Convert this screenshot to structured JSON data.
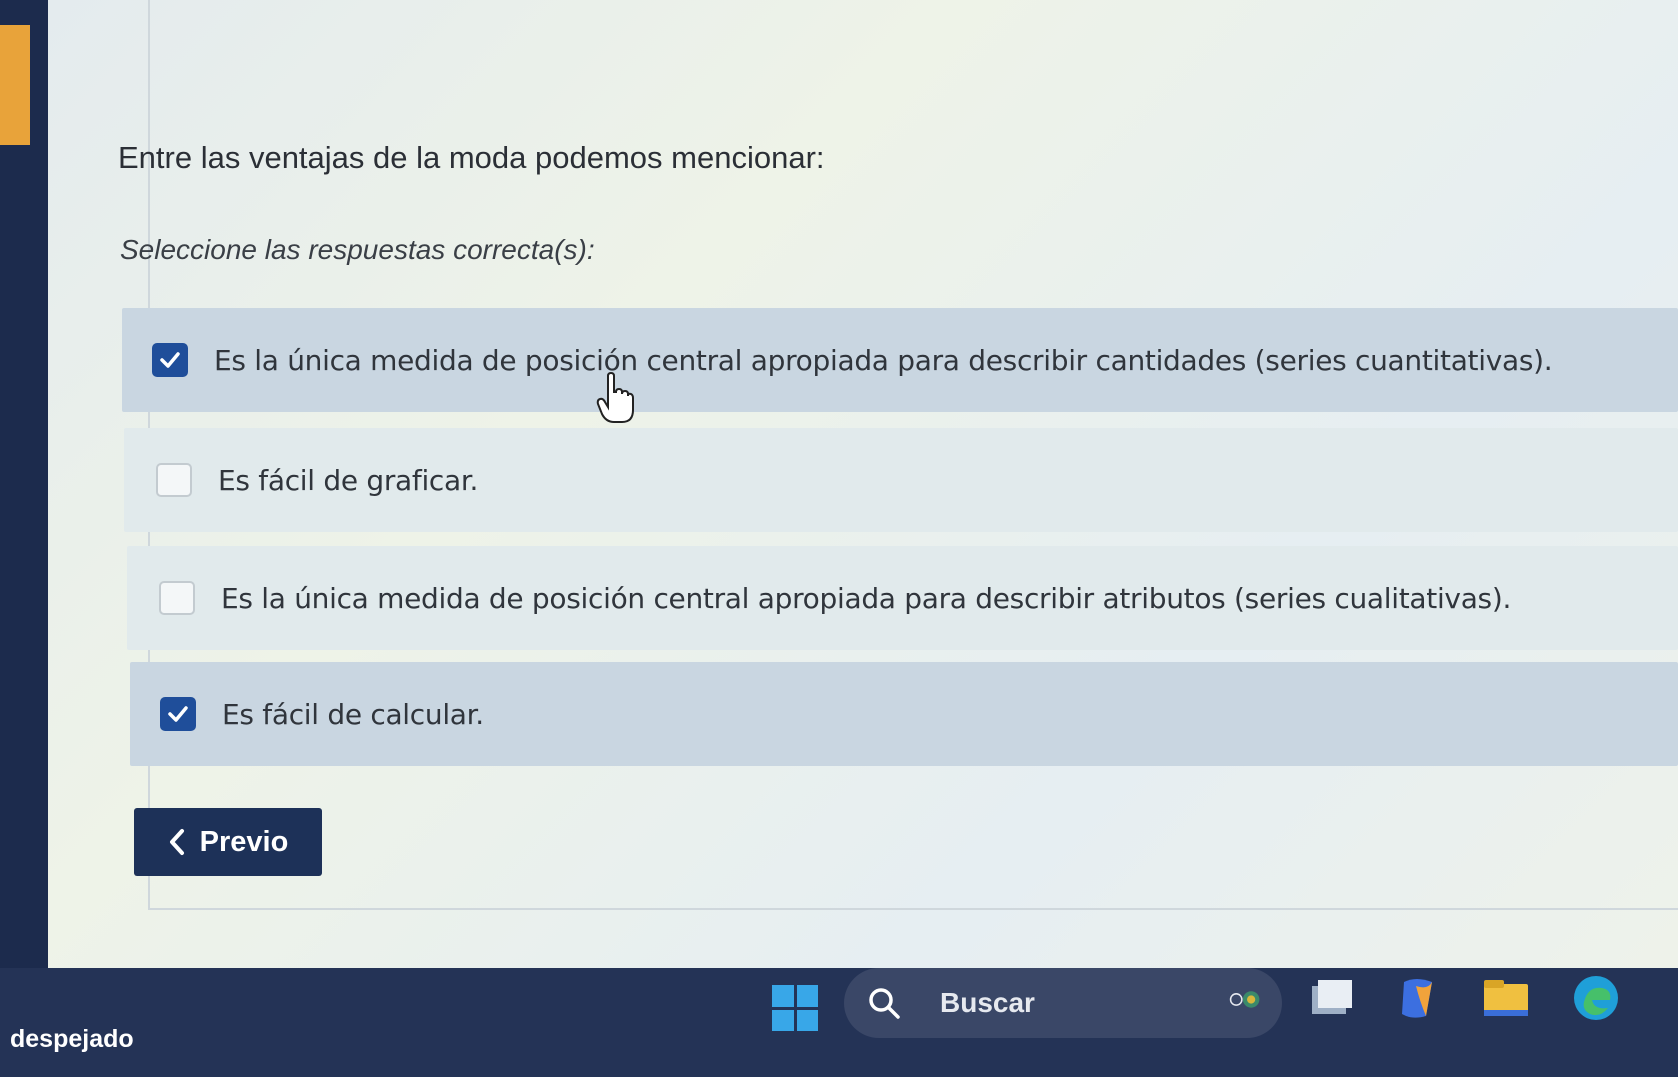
{
  "question": {
    "text": "Entre las ventajas de la moda podemos mencionar:",
    "instruction": "Seleccione las respuestas correcta(s):"
  },
  "options": [
    {
      "label": "Es la única medida de posición central apropiada para describir cantidades (series cuantitativas).",
      "checked": true
    },
    {
      "label": "Es fácil de graficar.",
      "checked": false
    },
    {
      "label": "Es la única medida de posición central apropiada para describir atributos (series cualitativas).",
      "checked": false
    },
    {
      "label": "Es fácil de calcular.",
      "checked": true
    }
  ],
  "navigation": {
    "prev_label": "Previo"
  },
  "taskbar": {
    "weather_text": "despejado",
    "search_label": "Buscar",
    "icons": [
      "windows-start-icon",
      "search-icon",
      "task-view-icon",
      "copilot-icon",
      "file-explorer-icon",
      "edge-icon"
    ]
  },
  "colors": {
    "accent": "#1f4e9a",
    "button_bg": "#1d3158",
    "left_accent": "#e8a33a"
  }
}
